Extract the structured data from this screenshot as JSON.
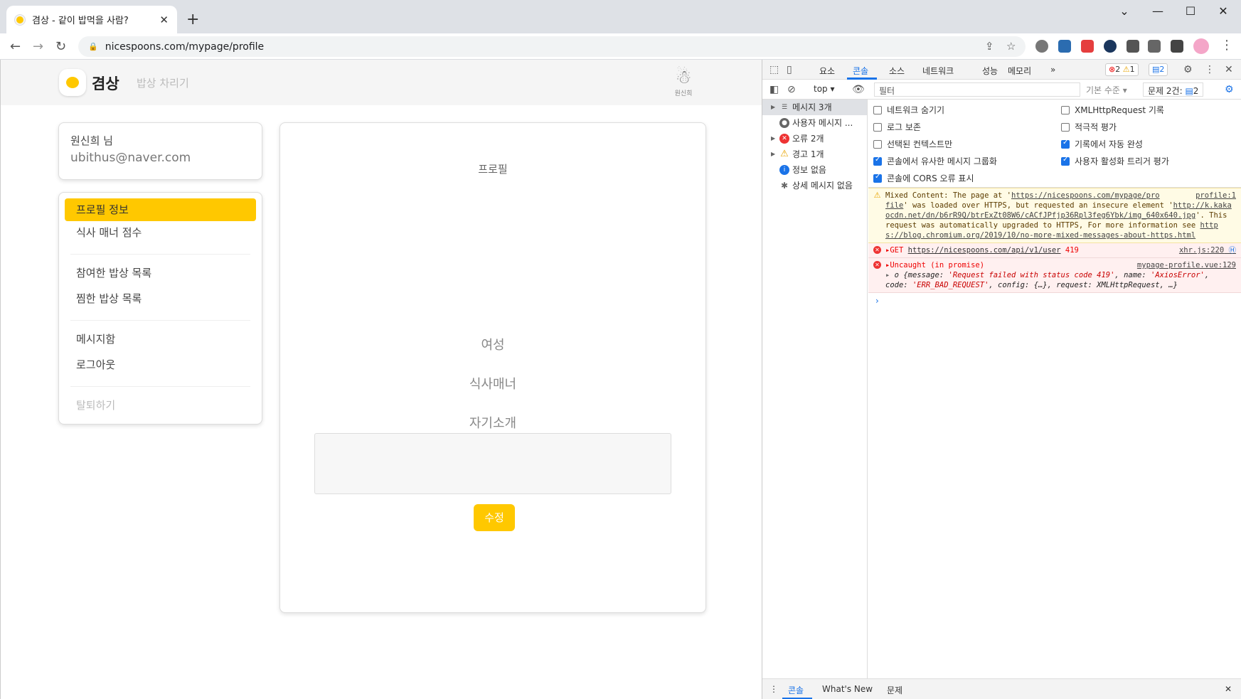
{
  "browser": {
    "tab_title": "겸상 - 같이 밥먹을 사람?",
    "tab_close": "✕",
    "new_tab": "+",
    "url": "nicespoons.com/mypage/profile",
    "win_min": "—",
    "win_max": "☐",
    "win_close": "✕",
    "win_chevron": "⌄"
  },
  "site": {
    "name": "겸상",
    "menu": "밥상 차리기",
    "user_short": "원신희"
  },
  "user_card": {
    "name": "원신희 님",
    "email": "ubithus@naver.com"
  },
  "menu": {
    "profile_info": "프로필 정보",
    "manner_score": "식사 매너 점수",
    "joined_list": "참여한 밥상 목록",
    "liked_list": "찜한 밥상 목록",
    "mailbox": "메시지함",
    "logout": "로그아웃",
    "withdraw": "탈퇴하기"
  },
  "profile": {
    "title": "프로필",
    "gender": "여성",
    "manner": "식사매너",
    "intro": "자기소개",
    "edit_button": "수정"
  },
  "devtools": {
    "tabs": [
      "요소",
      "콘솔",
      "소스",
      "네트워크",
      "성능",
      "메모리"
    ],
    "more": "»",
    "error_count": "2",
    "warn_count": "1",
    "info_count": "2",
    "context": "top",
    "filter_placeholder": "필터",
    "levels": "기본 수준",
    "issues_label": "문제 2건:",
    "issues_count": "2",
    "sidebar": [
      {
        "label": "메시지 3개"
      },
      {
        "label": "사용자 메시지 ..."
      },
      {
        "label": "오류 2개"
      },
      {
        "label": "경고 1개"
      },
      {
        "label": "정보 없음"
      },
      {
        "label": "상세 메시지 없음"
      }
    ],
    "options": {
      "hide_network": "네트워크 숨기기",
      "preserve_log": "로그 보존",
      "selected_context": "선택된 컨텍스트만",
      "group_similar": "콘솔에서 유사한 메시지 그룹화",
      "show_cors": "콘솔에 CORS 오류 표시",
      "xhr_log": "XMLHttpRequest 기록",
      "eager_eval": "적극적 평가",
      "autocomplete": "기록에서 자동 완성",
      "user_activation": "사용자 활성화 트리거 평가"
    },
    "warn_msg": {
      "p1": "Mixed Content: The page at '",
      "link1": "https://nicespoons.com/mypage/pro",
      "src": "profile:1",
      "link1b": "file",
      "p2": "' was loaded over HTTPS, but requested an insecure element '",
      "link2": "http://k.kakaocdn.net/dn/b6rR9Q/btrExZt08W6/cACfJPfjp36Rpl3feg6Ybk/img_640x640.jpg",
      "p3": "'. This request was automatically upgraded to HTTPS, For more information see ",
      "link3": "https://blog.chromium.org/2019/10/no-more-mixed-messages-about-https.html"
    },
    "err1": {
      "method": "GET",
      "url": "https://nicespoons.com/api/v1/user",
      "code": "419",
      "src": "xhr.js:220"
    },
    "err2": {
      "title": "Uncaught (in promise)",
      "src": "mypage-profile.vue:129",
      "l1a": "o {message: ",
      "l1b": "'Request failed with status code 419'",
      "l1c": ", name: ",
      "l1d": "'AxiosError'",
      "l1e": ",",
      "l2a": "code: ",
      "l2b": "'ERR_BAD_REQUEST'",
      "l2c": ", config: {…}, request: XMLHttpRequest, …}"
    },
    "prompt": "›",
    "drawer": {
      "console": "콘솔",
      "whats_new": "What's New",
      "issues": "문제",
      "close": "✕"
    }
  }
}
